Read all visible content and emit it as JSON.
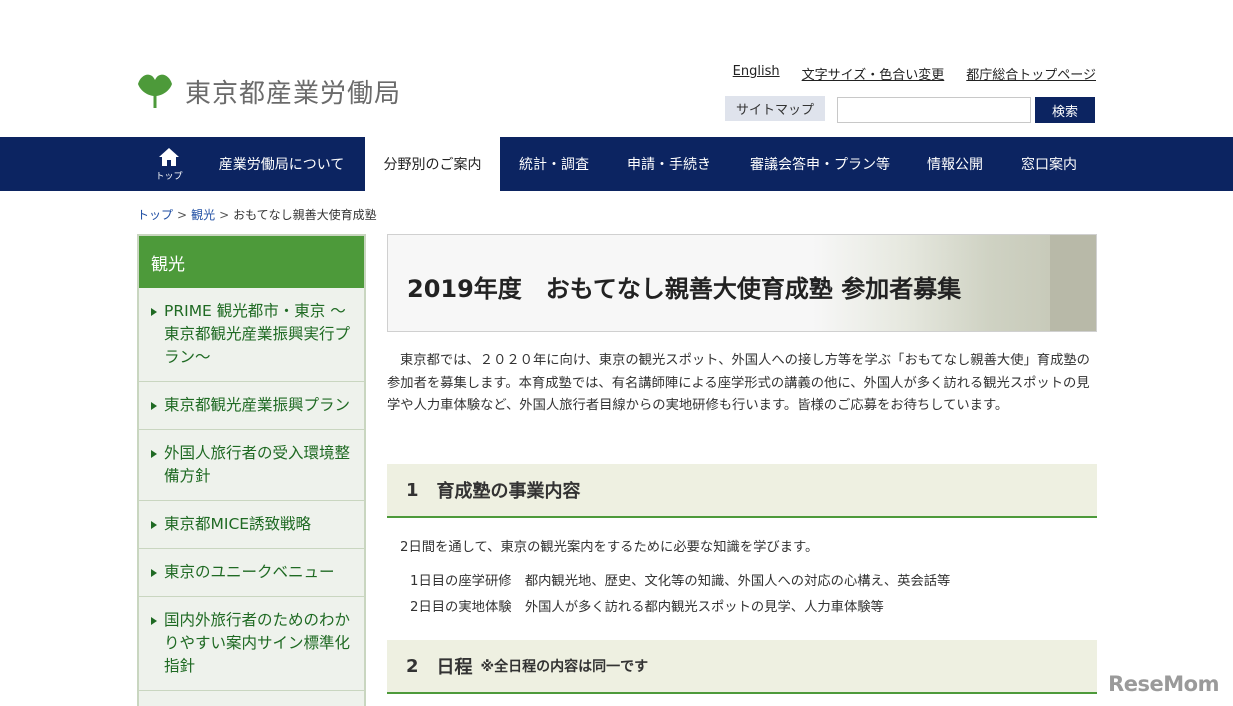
{
  "header": {
    "logo_text": "東京都産業労働局",
    "util_links": [
      "English",
      "文字サイズ・色合い変更",
      "都庁総合トップページ"
    ],
    "sitemap_label": "サイトマップ",
    "search_placeholder": "",
    "search_label": "検索"
  },
  "nav": {
    "home_label": "トップ",
    "items": [
      "産業労働局について",
      "分野別のご案内",
      "統計・調査",
      "申請・手続き",
      "審議会答申・プラン等",
      "情報公開",
      "窓口案内"
    ],
    "active_index": 1
  },
  "breadcrumb": {
    "items": [
      "トップ",
      "観光"
    ],
    "current": "おもてなし親善大使育成塾",
    "separator": ">"
  },
  "sidebar": {
    "heading": "観光",
    "items": [
      "PRIME 観光都市・東京 ～東京都観光産業振興実行プラン～",
      "東京都観光産業振興プラン",
      "外国人旅行者の受入環境整備方針",
      "東京都MICE誘致戦略",
      "東京のユニークベニュー",
      "国内外旅行者のためのわかりやすい案内サイン標準化指針"
    ]
  },
  "main": {
    "title": "2019年度　おもてなし親善大使育成塾 参加者募集",
    "intro": "東京都では、２０２０年に向け、東京の観光スポット、外国人への接し方等を学ぶ「おもてなし親善大使」育成塾の参加者を募集します。本育成塾では、有名講師陣による座学形式の講義の他に、外国人が多く訪れる観光スポットの見学や人力車体験など、外国人旅行者目線からの実地研修も行います。皆様のご応募をお待ちしています。",
    "section1": {
      "num": "1",
      "title": "育成塾の事業内容",
      "body": "2日間を通して、東京の観光案内をするために必要な知識を学びます。",
      "lines": [
        "1日目の座学研修　都内観光地、歴史、文化等の知識、外国人への対応の心構え、英会話等",
        "2日目の実地体験　外国人が多く訪れる都内観光スポットの見学、人力車体験等"
      ]
    },
    "section2": {
      "num": "2",
      "title": "日程",
      "note": "※全日程の内容は同一です"
    }
  },
  "watermark": "ReseMom",
  "colors": {
    "nav_bg": "#0c2461",
    "accent_green": "#4d9a3a",
    "link_green": "#1f6a23",
    "section_bg": "#eef0e1"
  }
}
